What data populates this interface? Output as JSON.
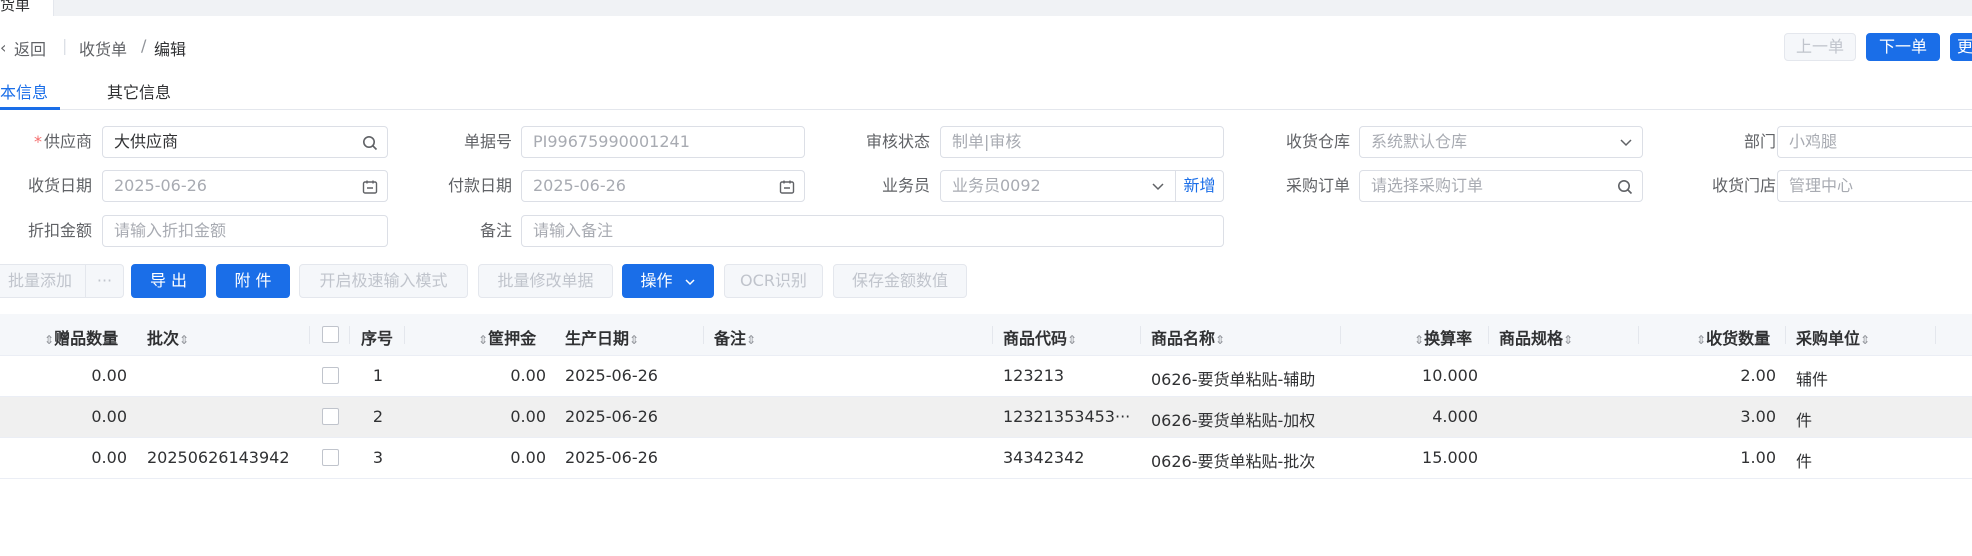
{
  "window": {
    "tab_label": "货单"
  },
  "breadcrumb": {
    "back_icon": "‹",
    "back": "返回",
    "sep": "|",
    "parent": "收货单",
    "slash": "/",
    "current": "编辑"
  },
  "nav": {
    "prev": "上一单",
    "next": "下一单",
    "more": "更"
  },
  "tabs": {
    "basic": "本信息",
    "other": "其它信息"
  },
  "form": {
    "supplier": {
      "label": "供应商",
      "value": "大供应商"
    },
    "doc_no": {
      "label": "单据号",
      "value": "PI99675990001241"
    },
    "audit_status": {
      "label": "审核状态",
      "value": "制单|审核"
    },
    "warehouse": {
      "label": "收货仓库",
      "value": "系统默认仓库"
    },
    "department": {
      "label": "部门",
      "value": "小鸡腿"
    },
    "receive_date": {
      "label": "收货日期",
      "value": "2025-06-26"
    },
    "pay_date": {
      "label": "付款日期",
      "value": "2025-06-26"
    },
    "salesman": {
      "label": "业务员",
      "value": "业务员0092",
      "add": "新增"
    },
    "purchase_order": {
      "label": "采购订单",
      "placeholder": "请选择采购订单"
    },
    "store": {
      "label": "收货门店",
      "value": "管理中心"
    },
    "discount": {
      "label": "折扣金额",
      "placeholder": "请输入折扣金额"
    },
    "remark": {
      "label": "备注",
      "placeholder": "请输入备注"
    }
  },
  "toolbar": {
    "batch_add": "批量添加",
    "more": "···",
    "export": "导 出",
    "attach": "附 件",
    "fast_mode": "开启极速输入模式",
    "batch_edit": "批量修改单据",
    "operate": "操作",
    "ocr": "OCR识别",
    "save_amount": "保存金额数值"
  },
  "table": {
    "headers": {
      "gift_qty": "赠品数量",
      "batch": "批次",
      "seq": "序号",
      "deposit": "筐押金",
      "prod_date": "生产日期",
      "remark": "备注",
      "code": "商品代码",
      "name": "商品名称",
      "ratio": "换算率",
      "spec": "商品规格",
      "qty": "收货数量",
      "unit": "采购单位"
    },
    "rows": [
      {
        "gift_qty": "0.00",
        "batch": "",
        "seq": "1",
        "deposit": "0.00",
        "prod_date": "2025-06-26",
        "code": "123213",
        "name": "0626-要货单粘贴-辅助",
        "ratio": "10.000",
        "qty": "2.00",
        "unit": "辅件"
      },
      {
        "gift_qty": "0.00",
        "batch": "",
        "seq": "2",
        "deposit": "0.00",
        "prod_date": "2025-06-26",
        "code": "12321353453···",
        "name": "0626-要货单粘贴-加权",
        "ratio": "4.000",
        "qty": "3.00",
        "unit": "件"
      },
      {
        "gift_qty": "0.00",
        "batch": "20250626143942",
        "seq": "3",
        "deposit": "0.00",
        "prod_date": "2025-06-26",
        "code": "34342342",
        "name": "0626-要货单粘贴-批次",
        "ratio": "15.000",
        "qty": "1.00",
        "unit": "件"
      }
    ]
  },
  "colors": {
    "primary": "#1a6ee8",
    "required": "#f56c6c",
    "border": "#dcdfe6"
  }
}
